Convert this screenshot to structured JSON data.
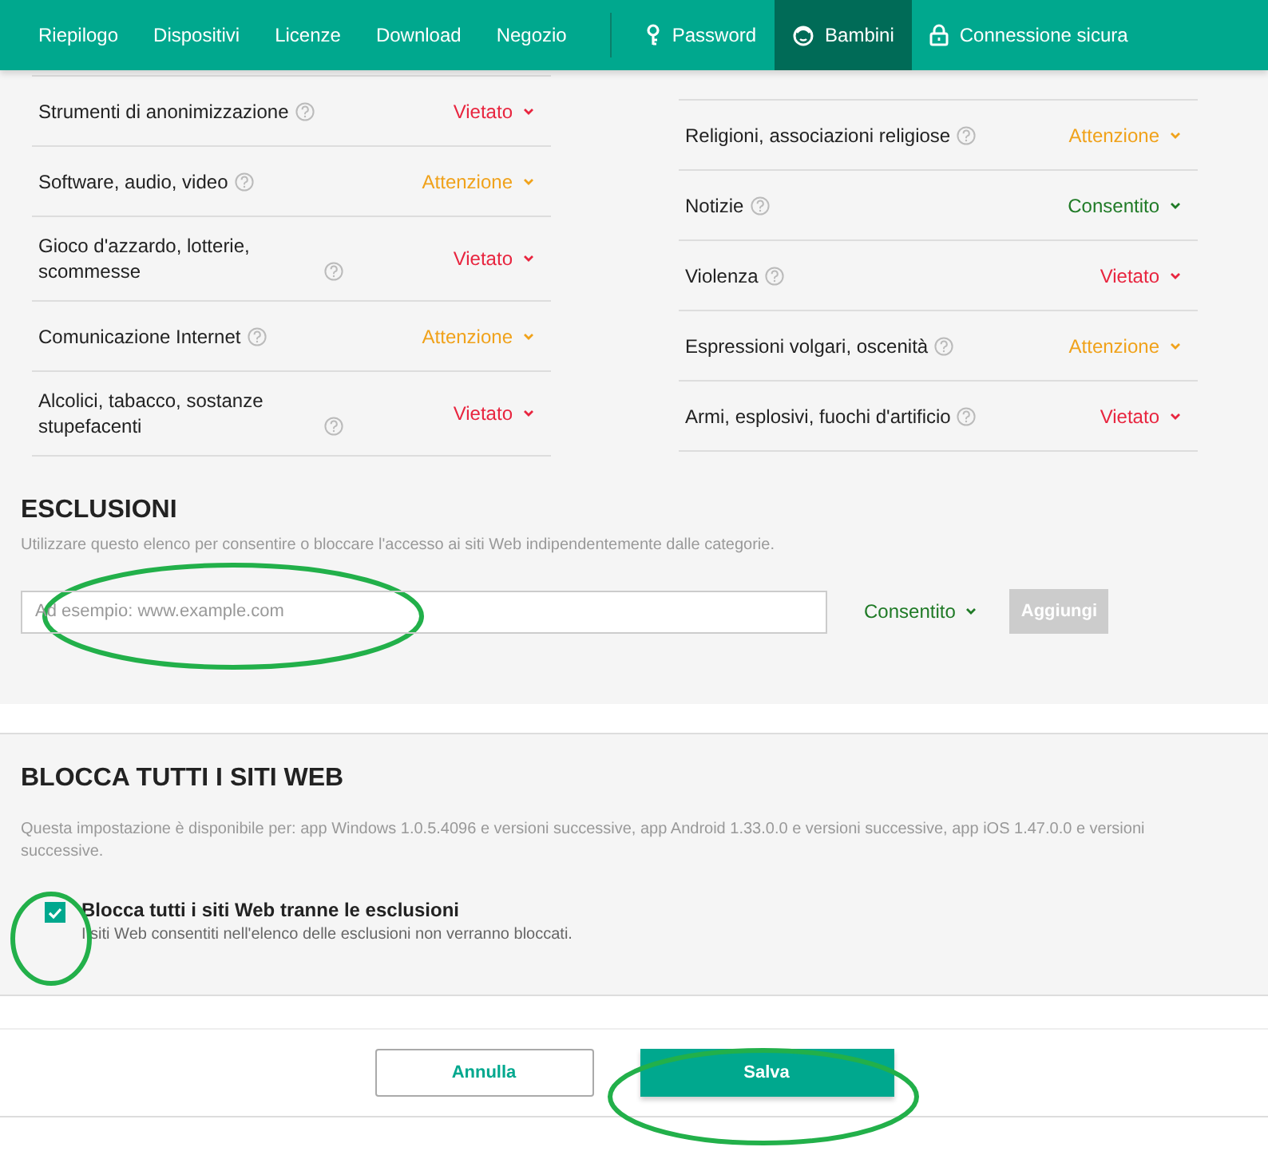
{
  "nav": {
    "left_items": [
      {
        "label": "Riepilogo",
        "selected": false
      },
      {
        "label": "Dispositivi",
        "selected": false
      },
      {
        "label": "Licenze",
        "selected": false
      },
      {
        "label": "Download",
        "selected": false
      },
      {
        "label": "Negozio",
        "selected": false
      }
    ],
    "right_items": [
      {
        "label": "Password",
        "selected": false
      },
      {
        "label": "Bambini",
        "selected": true
      },
      {
        "label": "Connessione sicura",
        "selected": false
      }
    ]
  },
  "categories": {
    "left": [
      {
        "label": "Strumenti di anonimizzazione",
        "status": "Vietato",
        "kind": "blocked"
      },
      {
        "label": "Software, audio, video",
        "status": "Attenzione",
        "kind": "warning"
      },
      {
        "label": "Gioco d'azzardo, lotterie, scommesse",
        "status": "Vietato",
        "kind": "blocked"
      },
      {
        "label": "Comunicazione Internet",
        "status": "Attenzione",
        "kind": "warning"
      },
      {
        "label": "Alcolici, tabacco, sostanze stupefacenti",
        "status": "Vietato",
        "kind": "blocked"
      }
    ],
    "right": [
      {
        "label": "Religioni, associazioni religiose",
        "status": "Attenzione",
        "kind": "warning"
      },
      {
        "label": "Notizie",
        "status": "Consentito",
        "kind": "allowed"
      },
      {
        "label": "Violenza",
        "status": "Vietato",
        "kind": "blocked"
      },
      {
        "label": "Espressioni volgari, oscenità",
        "status": "Attenzione",
        "kind": "warning"
      },
      {
        "label": "Armi, esplosivi, fuochi d'artificio",
        "status": "Vietato",
        "kind": "blocked"
      }
    ]
  },
  "exclusions": {
    "title": "ESCLUSIONI",
    "description": "Utilizzare questo elenco per consentire o bloccare l'accesso ai siti Web indipendentemente dalle categorie.",
    "placeholder": "Ad esempio: www.example.com",
    "mode": {
      "label": "Consentito",
      "kind": "allowed"
    },
    "add_button": {
      "label": "Aggiungi",
      "disabled": true
    }
  },
  "block_all": {
    "title": "BLOCCA TUTTI I SITI WEB",
    "description": "Questa impostazione è disponibile per: app Windows 1.0.5.4096 e versioni successive, app Android 1.33.0.0 e versioni successive, app iOS 1.47.0.0 e versioni successive.",
    "checkbox": {
      "label": "Blocca tutti i siti Web tranne le esclusioni",
      "hint": "I siti Web consentiti nell'elenco delle esclusioni non verranno bloccati.",
      "checked": true
    }
  },
  "footer": {
    "cancel": "Annulla",
    "save": "Salva"
  }
}
